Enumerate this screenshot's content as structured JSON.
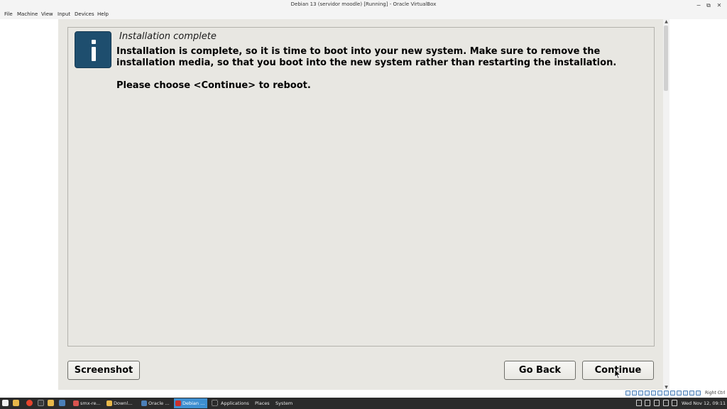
{
  "window": {
    "title": "Debian 13 (servidor moodle) [Running] - Oracle VirtualBox",
    "controls": {
      "minimize": "−",
      "restore": "⧉",
      "close": "✕"
    }
  },
  "menubar": {
    "items": [
      "File",
      "Machine",
      "View",
      "Input",
      "Devices",
      "Help"
    ]
  },
  "installer": {
    "panel_title": "Installation complete",
    "message": "Installation is complete, so it is time to boot into your new system. Make sure to remove the installation media, so that you boot into the new system rather than restarting the installation.",
    "prompt": "Please choose <Continue> to reboot.",
    "icon": "info-icon",
    "buttons": {
      "screenshot": "Screenshot",
      "go_back": "Go Back",
      "continue": "Continue"
    }
  },
  "scrollbar": {
    "up": "▲",
    "down": "▼"
  },
  "statusbar": {
    "host_key": "Right Ctrl"
  },
  "taskbar": {
    "windows": [
      {
        "label": "smx-re...",
        "icon_color": "#d9534f"
      },
      {
        "label": "Downl...",
        "icon_color": "#e8b84a"
      },
      {
        "label": "Oracle ...",
        "icon_color": "#4b7fb8"
      },
      {
        "label": "Debian ...",
        "icon_color": "#c9302c",
        "active": true
      }
    ],
    "menu": [
      "Applications",
      "Places",
      "System"
    ],
    "clock": "Wed Nov 12, 09:11"
  },
  "colors": {
    "installer_bg": "#e8e7e2",
    "info_icon": "#1e4e6e",
    "taskbar_active": "#3d8fd1"
  }
}
